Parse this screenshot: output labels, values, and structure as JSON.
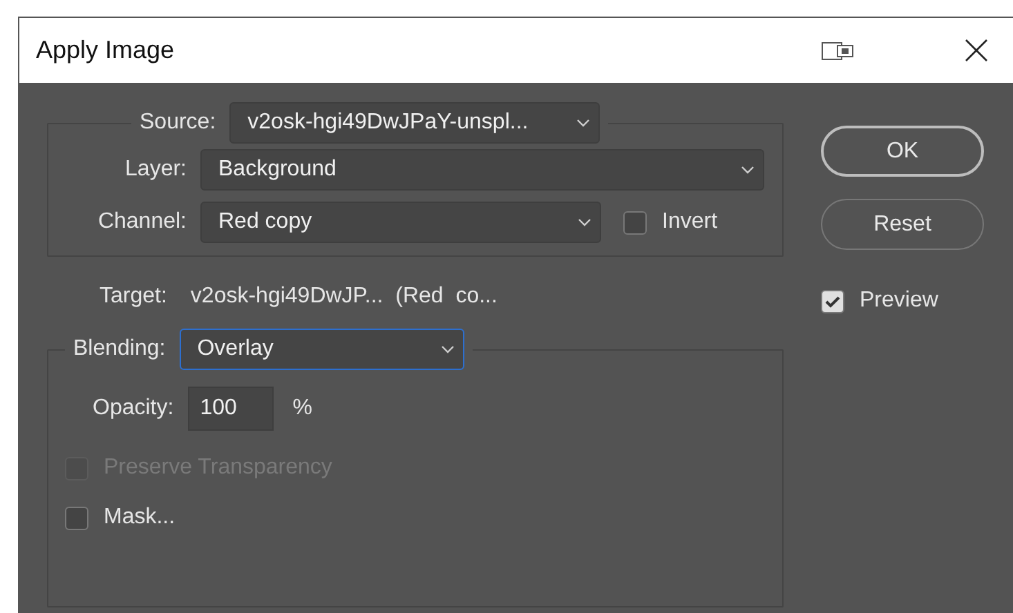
{
  "window": {
    "title": "Apply Image"
  },
  "source": {
    "label": "Source:",
    "value": "v2osk-hgi49DwJPaY-unspl..."
  },
  "layer": {
    "label": "Layer:",
    "value": "Background"
  },
  "channel": {
    "label": "Channel:",
    "value": "Red copy"
  },
  "invert": {
    "label": "Invert",
    "checked": false
  },
  "target": {
    "label": "Target:",
    "value": "v2osk-hgi49DwJP...  (Red  co..."
  },
  "blending": {
    "label": "Blending:",
    "value": "Overlay",
    "focused": true
  },
  "opacity": {
    "label": "Opacity:",
    "value": "100",
    "unit": "%"
  },
  "options": [
    {
      "label": "Preserve Transparency",
      "checked": false,
      "disabled": true
    },
    {
      "label": "Mask...",
      "checked": false,
      "disabled": false
    }
  ],
  "buttons": [
    {
      "label": "OK",
      "default": true
    },
    {
      "label": "Reset",
      "default": false
    }
  ],
  "preview": {
    "label": "Preview",
    "checked": true
  }
}
